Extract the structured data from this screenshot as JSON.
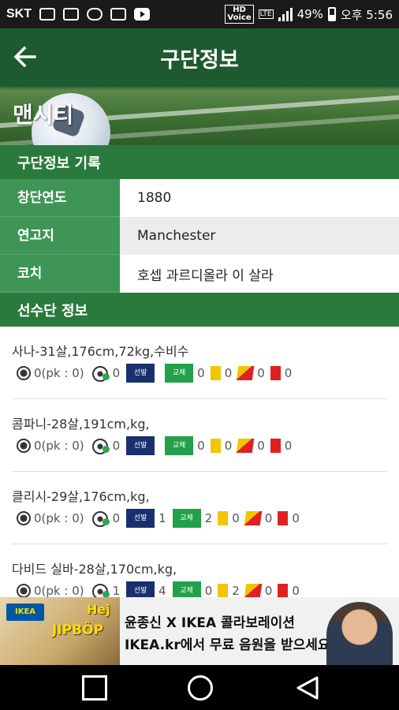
{
  "status_bar": {
    "carrier": "SKT",
    "hd": "HD",
    "voice": "Voice",
    "lte": "LTE",
    "battery": "49%",
    "time": "오후 5:56"
  },
  "app_bar": {
    "title": "구단정보"
  },
  "club": {
    "name": "맨시티"
  },
  "club_info": {
    "header": "구단정보 기록",
    "rows": [
      {
        "label": "창단연도",
        "value": "1880"
      },
      {
        "label": "연고지",
        "value": "Manchester"
      },
      {
        "label": "코치",
        "value": "호셉 과르디올라 이 살라"
      }
    ]
  },
  "players_section": {
    "header": "선수단 정보",
    "badge_start": "선발",
    "badge_sub": "교체",
    "players": [
      {
        "name": "사나-31살,176cm,72kg,수비수",
        "goals": "0(pk : 0)",
        "assists": "0",
        "starts": "",
        "subs": "0",
        "yellow": "0",
        "yellow_red": "0",
        "red": "0"
      },
      {
        "name": "콤파니-28살,191cm,kg,",
        "goals": "0(pk : 0)",
        "assists": "0",
        "starts": "",
        "subs": "0",
        "yellow": "0",
        "yellow_red": "0",
        "red": "0"
      },
      {
        "name": "클리시-29살,176cm,kg,",
        "goals": "0(pk : 0)",
        "assists": "0",
        "starts": "1",
        "subs": "2",
        "yellow": "0",
        "yellow_red": "0",
        "red": "0"
      },
      {
        "name": "다비드 실바-28살,170cm,kg,",
        "goals": "0(pk : 0)",
        "assists": "1",
        "starts": "4",
        "subs": "0",
        "yellow": "2",
        "yellow_red": "0",
        "red": "0"
      }
    ]
  },
  "ad": {
    "brand": "IKEA",
    "tag1": "Hej",
    "tag2": "JIPBÖP",
    "line1": "윤종신 X IKEA 콜라보레이션",
    "line2": "IKEA.kr에서 무료 음원을 받으세요!"
  },
  "colors": {
    "app_bar": "#1e5a2f",
    "section_header": "#2a7a3e",
    "label_cell": "#3e9556",
    "badge_start": "#1a2f6e",
    "badge_sub": "#22a14a",
    "yellow_card": "#f2c500",
    "red_card": "#e02020"
  },
  "icons": {
    "back": "arrow-left-icon",
    "goal": "soccer-ball-icon",
    "assist": "assist-ball-icon",
    "nav_recent": "square-icon",
    "nav_home": "circle-icon",
    "nav_back": "triangle-back-icon"
  }
}
